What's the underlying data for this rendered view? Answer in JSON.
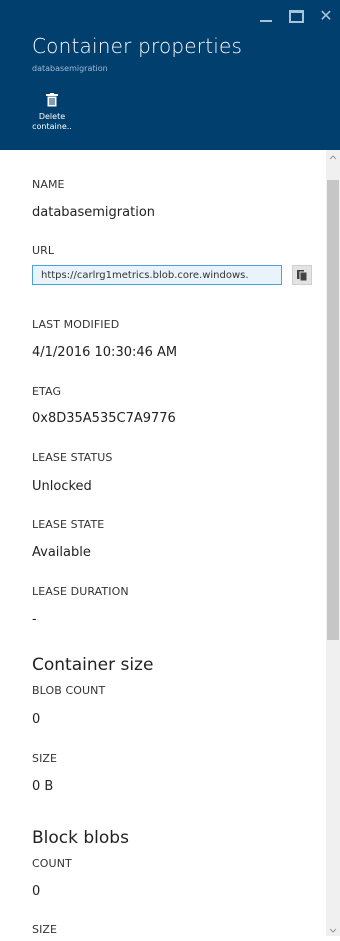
{
  "header": {
    "title": "Container properties",
    "subtitle": "databasemigration",
    "commands": [
      {
        "label": "Delete containe..",
        "icon": "trash-icon"
      }
    ],
    "window_controls": [
      "minimize-icon",
      "maximize-icon",
      "close-icon"
    ]
  },
  "properties": {
    "name_label": "NAME",
    "name_value": "databasemigration",
    "url_label": "URL",
    "url_value": "https://carlrg1metrics.blob.core.windows.",
    "last_modified_label": "LAST MODIFIED",
    "last_modified_value": "4/1/2016 10:30:46 AM",
    "etag_label": "ETAG",
    "etag_value": "0x8D35A535C7A9776",
    "lease_status_label": "LEASE STATUS",
    "lease_status_value": "Unlocked",
    "lease_state_label": "LEASE STATE",
    "lease_state_value": "Available",
    "lease_duration_label": "LEASE DURATION",
    "lease_duration_value": "-"
  },
  "container_size": {
    "title": "Container size",
    "blob_count_label": "BLOB COUNT",
    "blob_count_value": "0",
    "size_label": "SIZE",
    "size_value": "0 B"
  },
  "block_blobs": {
    "title": "Block blobs",
    "count_label": "COUNT",
    "count_value": "0",
    "size_label": "SIZE"
  },
  "colors": {
    "header_bg": "#003f6e",
    "url_border": "#4aa3df",
    "url_bg": "#e8f3fb"
  }
}
